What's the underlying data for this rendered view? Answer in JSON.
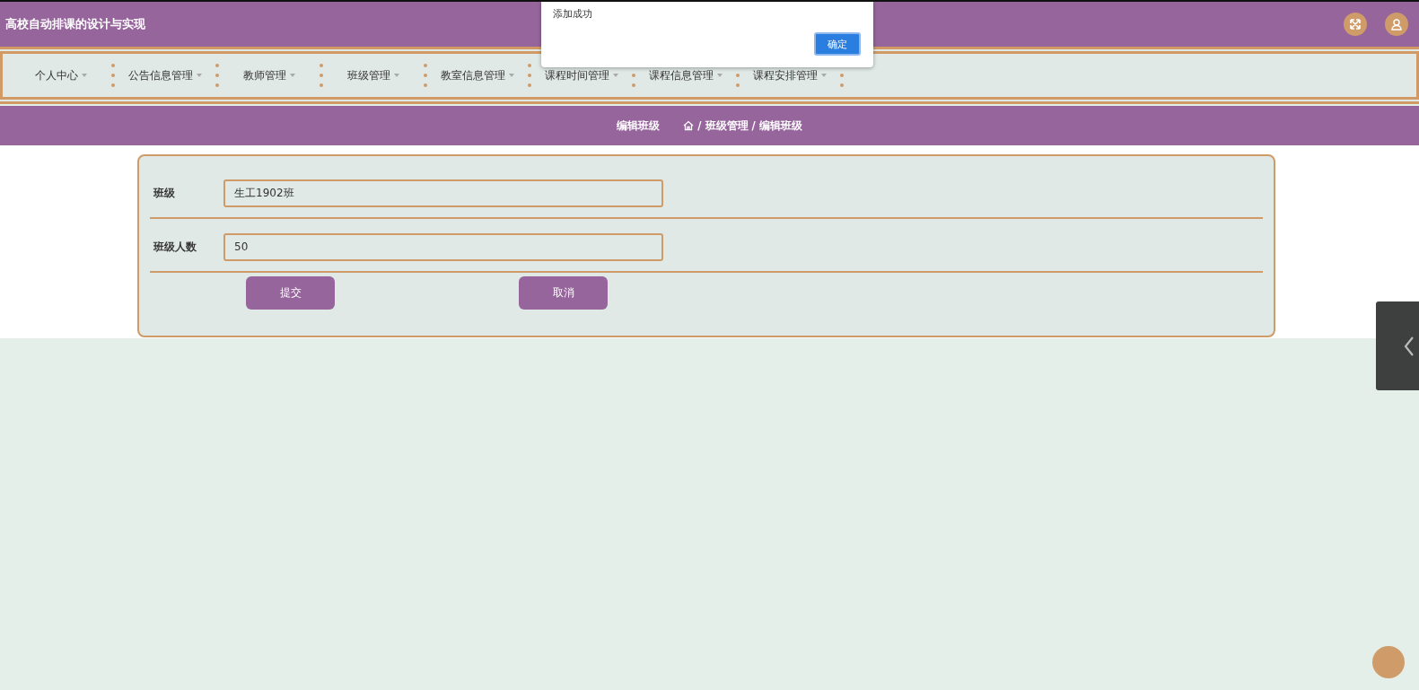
{
  "header": {
    "title": "高校自动排课的设计与实现"
  },
  "nav": [
    {
      "label": "个人中心"
    },
    {
      "label": "公告信息管理"
    },
    {
      "label": "教师管理"
    },
    {
      "label": "班级管理"
    },
    {
      "label": "教室信息管理"
    },
    {
      "label": "课程时间管理"
    },
    {
      "label": "课程信息管理"
    },
    {
      "label": "课程安排管理"
    }
  ],
  "breadcrumb": {
    "title": "编辑班级",
    "path": [
      "班级管理",
      "编辑班级"
    ],
    "separator": "/"
  },
  "form": {
    "fields": [
      {
        "label": "班级",
        "value": "生工1902班"
      },
      {
        "label": "班级人数",
        "value": "50"
      }
    ],
    "buttons": [
      "提交",
      "取消"
    ]
  },
  "alert": {
    "message": "添加成功",
    "button": "确定"
  }
}
